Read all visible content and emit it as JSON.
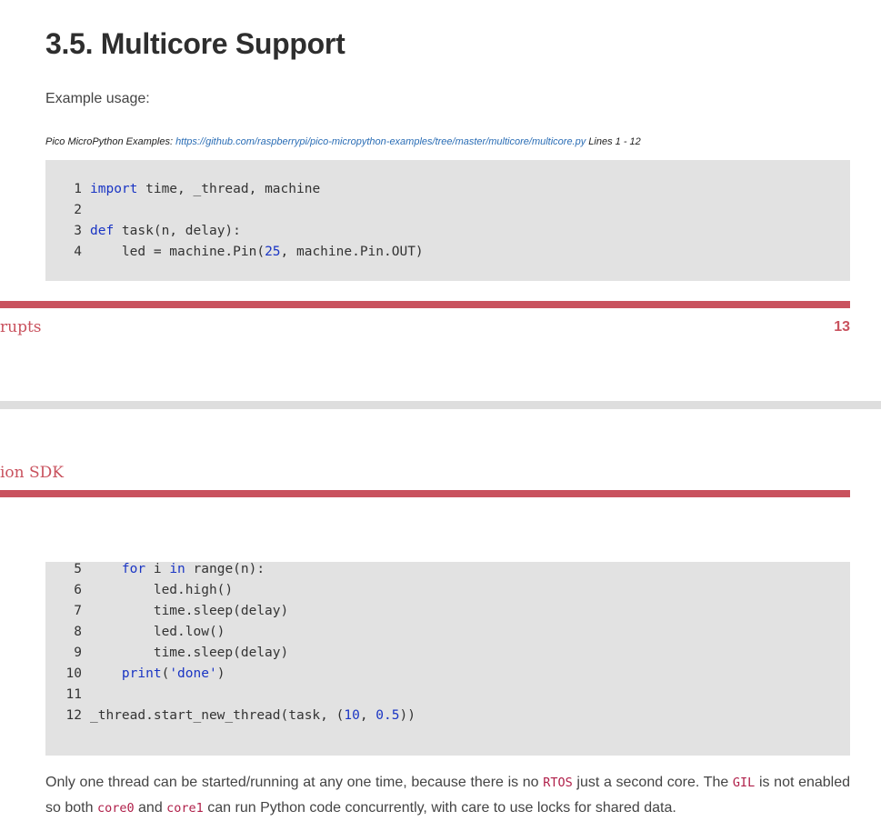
{
  "heading": "3.5. Multicore Support",
  "intro": "Example usage:",
  "source": {
    "prefix": "Pico MicroPython Examples:",
    "url": "https://github.com/raspberrypi/pico-micropython-examples/tree/master/multicore/multicore.py",
    "lines": "Lines 1 - 12"
  },
  "code_top": [
    {
      "n": "1",
      "parts": [
        [
          "kw",
          "import"
        ],
        [
          "t",
          " time, _thread, machine"
        ]
      ]
    },
    {
      "n": "2",
      "parts": []
    },
    {
      "n": "3",
      "parts": [
        [
          "kw",
          "def"
        ],
        [
          "t",
          " task(n, delay):"
        ]
      ]
    },
    {
      "n": "4",
      "parts": [
        [
          "t",
          "    led = machine.Pin("
        ],
        [
          "num",
          "25"
        ],
        [
          "t",
          ", machine.Pin.OUT)"
        ]
      ]
    }
  ],
  "footer": {
    "section_fragment": "rupts",
    "page_number": "13"
  },
  "next_header": {
    "section_fragment": "ion SDK"
  },
  "code_bottom": [
    {
      "n": "5",
      "parts": [
        [
          "t",
          "    "
        ],
        [
          "kw",
          "for"
        ],
        [
          "t",
          " i "
        ],
        [
          "kw",
          "in"
        ],
        [
          "t",
          " range(n):"
        ]
      ]
    },
    {
      "n": "6",
      "parts": [
        [
          "t",
          "        led.high()"
        ]
      ]
    },
    {
      "n": "7",
      "parts": [
        [
          "t",
          "        time.sleep(delay)"
        ]
      ]
    },
    {
      "n": "8",
      "parts": [
        [
          "t",
          "        led.low()"
        ]
      ]
    },
    {
      "n": "9",
      "parts": [
        [
          "t",
          "        time.sleep(delay)"
        ]
      ]
    },
    {
      "n": "10",
      "parts": [
        [
          "t",
          "    "
        ],
        [
          "kw",
          "print"
        ],
        [
          "t",
          "("
        ],
        [
          "str",
          "'done'"
        ],
        [
          "t",
          ")"
        ]
      ]
    },
    {
      "n": "11",
      "parts": []
    },
    {
      "n": "12",
      "parts": [
        [
          "t",
          "_thread.start_new_thread(task, ("
        ],
        [
          "num",
          "10"
        ],
        [
          "t",
          ", "
        ],
        [
          "num",
          "0.5"
        ],
        [
          "t",
          "))"
        ]
      ]
    }
  ],
  "paragraph": {
    "t1": "Only one thread can be started/running at any one time, because there is no ",
    "c1": "RTOS",
    "t2": " just a second core. The ",
    "c2": "GIL",
    "t3": " is not enabled so both ",
    "c3": "core0",
    "t4": " and ",
    "c4": "core1",
    "t5": " can run Python code concurrently, with care to use locks for shared data."
  },
  "colors": {
    "accent": "#c9525e",
    "code_bg": "#e2e2e2",
    "keyword": "#1a35c4",
    "inline_code": "#b0204a"
  }
}
